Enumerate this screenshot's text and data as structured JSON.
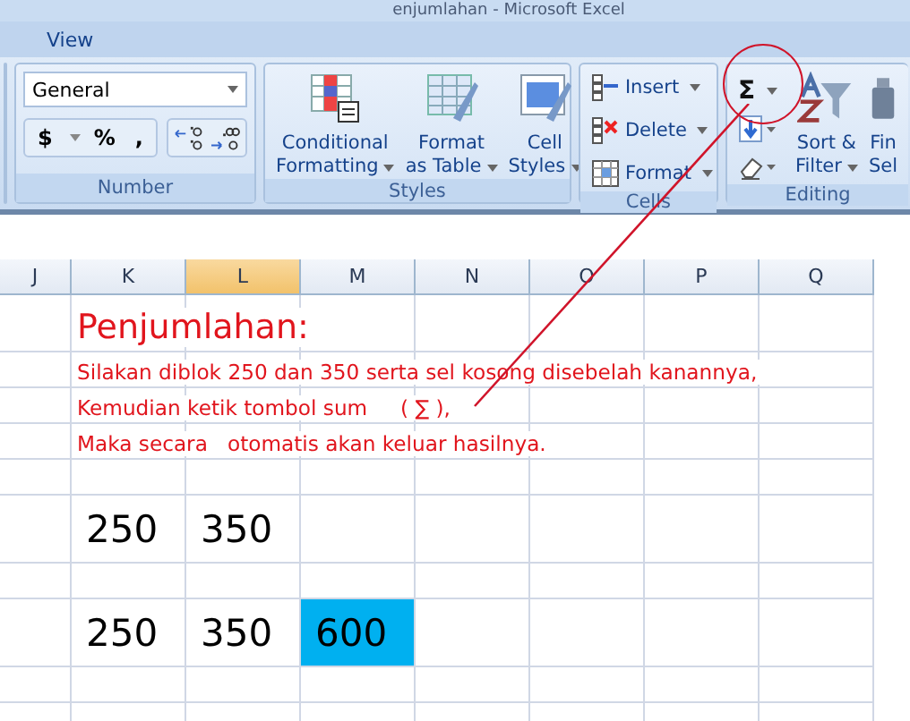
{
  "window": {
    "title": "enjumlahan - Microsoft Excel"
  },
  "tabs": [
    {
      "label": "View",
      "selected": false
    }
  ],
  "ribbon": {
    "number": {
      "label": "Number",
      "format": "General",
      "buttons": [
        "$",
        "%",
        ","
      ]
    },
    "styles": {
      "label": "Styles",
      "buttons": [
        {
          "kind": "conditional",
          "lines": [
            "Conditional",
            "Formatting"
          ]
        },
        {
          "kind": "table",
          "lines": [
            "Format",
            "as Table"
          ]
        },
        {
          "kind": "cellstyles",
          "lines": [
            "Cell",
            "Styles"
          ]
        }
      ]
    },
    "cells": {
      "label": "Cells",
      "buttons": [
        {
          "kind": "insert",
          "label": "Insert"
        },
        {
          "kind": "delete",
          "label": "Delete"
        },
        {
          "kind": "format",
          "label": "Format"
        }
      ]
    },
    "editing": {
      "label": "Editing",
      "autosum": "Σ",
      "buttons": [
        {
          "kind": "sort",
          "lines": [
            "Sort &",
            "Filter"
          ]
        },
        {
          "kind": "find",
          "lines": [
            "Fin",
            "Sel"
          ]
        }
      ]
    }
  },
  "sheet": {
    "columns": [
      {
        "label": "J",
        "selected": false
      },
      {
        "label": "K",
        "selected": false
      },
      {
        "label": "L",
        "selected": true
      },
      {
        "label": "M",
        "selected": false
      },
      {
        "label": "N",
        "selected": false
      },
      {
        "label": "O",
        "selected": false
      },
      {
        "label": "P",
        "selected": false
      },
      {
        "label": "Q",
        "selected": false
      }
    ],
    "rows": [
      {
        "kind": "title",
        "text": "Penjumlahan:"
      },
      {
        "kind": "note",
        "text": "Silakan diblok 250 dan 350 serta sel kosong disebelah kanannya,"
      },
      {
        "kind": "note",
        "text": "Kemudian ketik tombol sum     ( ∑ ),"
      },
      {
        "kind": "note",
        "text": "Maka secara   otomatis akan keluar hasilnya."
      },
      {
        "kind": "values",
        "cells": [
          {
            "text": "250",
            "highlighted": false
          },
          {
            "text": "350",
            "highlighted": false
          }
        ]
      },
      {
        "kind": "values",
        "cells": [
          {
            "text": "250",
            "highlighted": false
          },
          {
            "text": "350",
            "highlighted": false
          },
          {
            "text": "600",
            "highlighted": true
          }
        ]
      }
    ]
  }
}
